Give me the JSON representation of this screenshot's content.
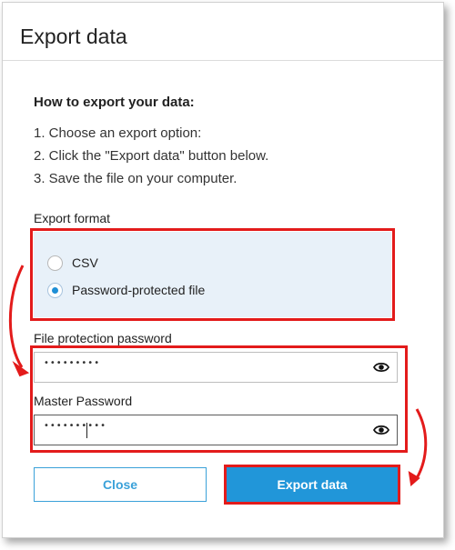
{
  "dialog": {
    "title": "Export data"
  },
  "instructions": {
    "heading": "How to export your data:",
    "steps": [
      "1. Choose an export option:",
      "2. Click the \"Export data\" button below.",
      "3. Save the file on your computer."
    ]
  },
  "export_format": {
    "label": "Export format",
    "options": [
      {
        "label": "CSV",
        "selected": false
      },
      {
        "label": "Password-protected file",
        "selected": true
      }
    ]
  },
  "file_protection": {
    "label": "File protection password",
    "value_masked": "•••••••••"
  },
  "master_password": {
    "label": "Master Password",
    "value_masked": "••••••••••"
  },
  "buttons": {
    "close": "Close",
    "export": "Export data"
  },
  "colors": {
    "accent": "#2196d9",
    "highlight": "#e31b1b",
    "panel": "#e8f1f9"
  },
  "icons": [
    "eye-icon",
    "eye-icon"
  ]
}
